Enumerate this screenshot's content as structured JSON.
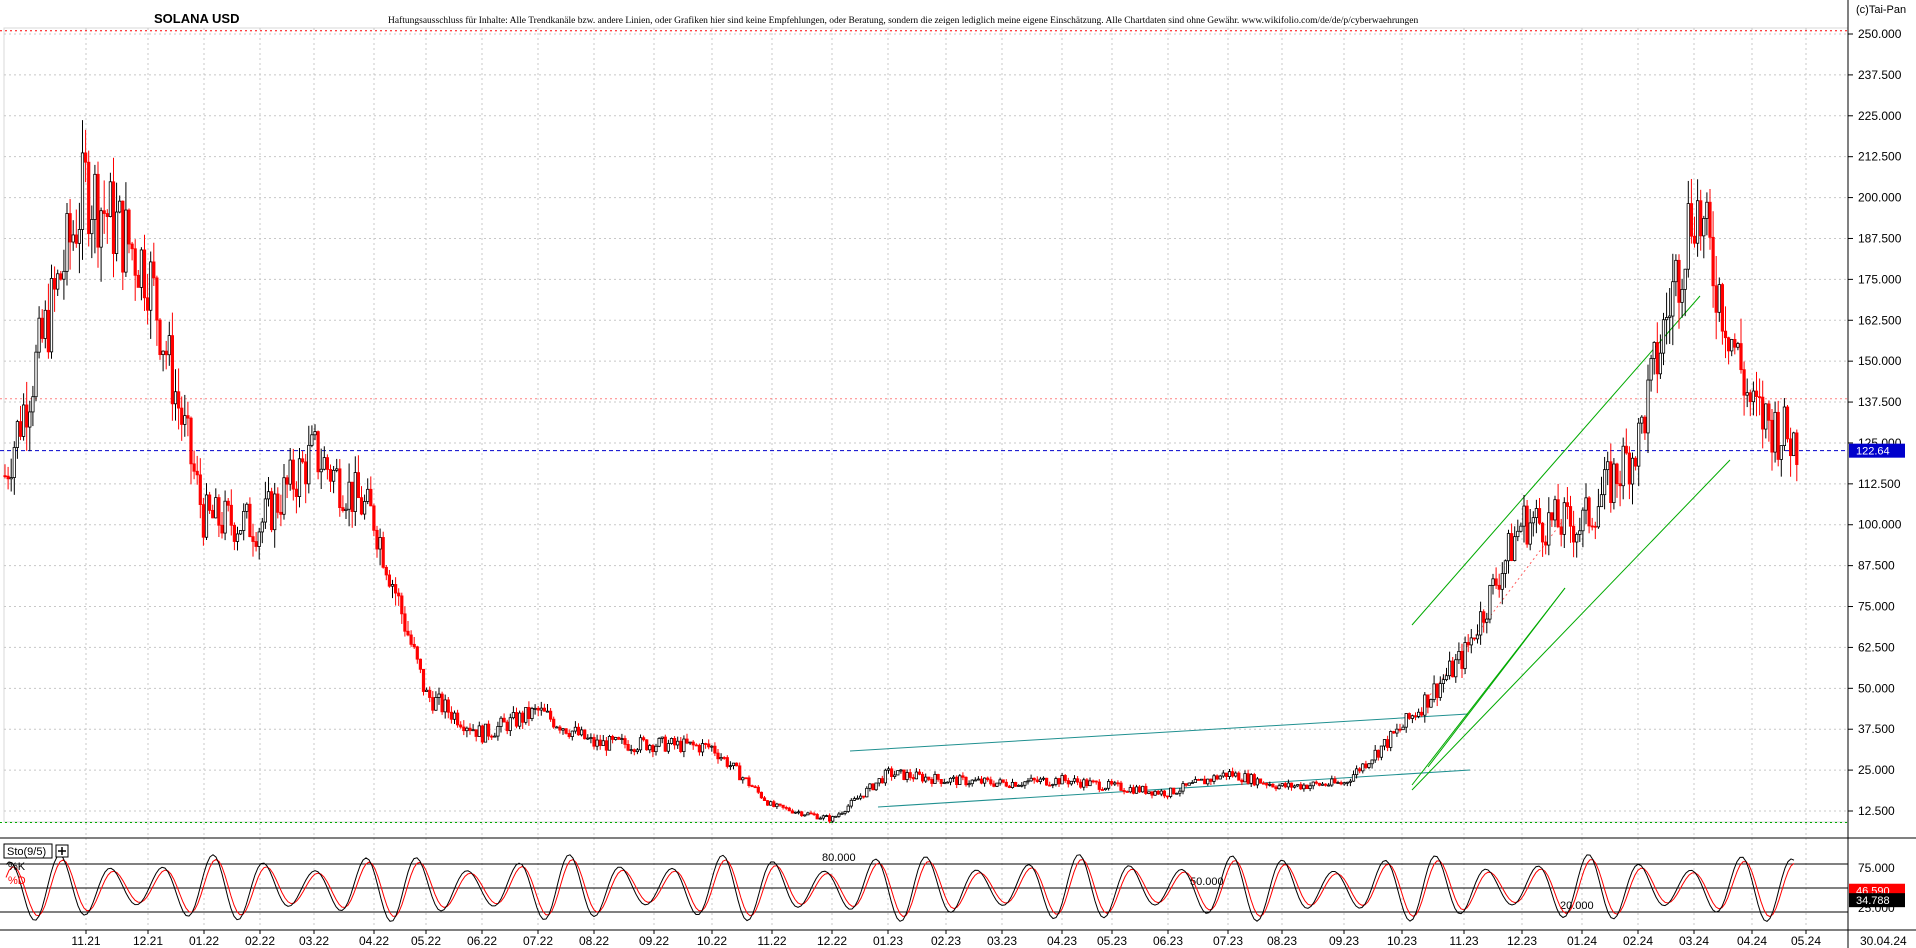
{
  "header": {
    "title": "SOLANA USD",
    "disclaimer": "Haftungsausschluss für Inhalte: Alle Trendkanäle bzw. andere Linien, oder Grafiken hier sind keine Empfehlungen, oder Beratung, sondern die zeigen lediglich meine eigene Einschätzung. Alle Chartdaten sind ohne Gewähr.  www.wikifolio.com/de/de/p/cyberwaehrungen",
    "copyright": "(c)Tai-Pan"
  },
  "colors": {
    "up": "#000000",
    "down": "#ff0000",
    "grid": "#c8c8c8",
    "channel": "#00aa00",
    "teal_channel": "#209090",
    "price_line": "#0000cc",
    "price_tag_bg": "#0000cc",
    "k_tag_bg": "#ff0000",
    "d_tag_bg": "#000000"
  },
  "chart_data": [
    {
      "type": "candlestick",
      "title": "SOLANA USD",
      "xlabel": "",
      "ylabel": "",
      "x_ticks": [
        "11.21",
        "12.21",
        "01.22",
        "02.22",
        "03.22",
        "04.22",
        "05.22",
        "06.22",
        "07.22",
        "08.22",
        "09.22",
        "10.22",
        "11.22",
        "12.22",
        "01.23",
        "02.23",
        "03.23",
        "04.23",
        "05.23",
        "06.23",
        "07.23",
        "08.23",
        "09.23",
        "10.23",
        "11.23",
        "12.23",
        "01.24",
        "02.24",
        "03.24",
        "04.24",
        "05.24"
      ],
      "x_end_label": "30.04.24",
      "y_ticks": [
        "12.500",
        "25.000",
        "37.500",
        "50.000",
        "62.500",
        "75.000",
        "87.500",
        "100.000",
        "112.500",
        "125.000",
        "137.500",
        "150.000",
        "162.500",
        "175.000",
        "187.500",
        "200.000",
        "212.500",
        "225.000",
        "237.500",
        "250.000"
      ],
      "ylim": [
        0,
        250
      ],
      "grid": true,
      "last_price": "122.64",
      "monthly_closes": [
        {
          "m": "11.21",
          "v": 204
        },
        {
          "m": "12.21",
          "v": 178
        },
        {
          "m": "01.22",
          "v": 102
        },
        {
          "m": "02.22",
          "v": 100
        },
        {
          "m": "03.22",
          "v": 122
        },
        {
          "m": "04.22",
          "v": 102
        },
        {
          "m": "05.22",
          "v": 48
        },
        {
          "m": "06.22",
          "v": 36
        },
        {
          "m": "07.22",
          "v": 43
        },
        {
          "m": "08.22",
          "v": 33
        },
        {
          "m": "09.22",
          "v": 33
        },
        {
          "m": "10.22",
          "v": 32
        },
        {
          "m": "11.22",
          "v": 14
        },
        {
          "m": "12.22",
          "v": 10
        },
        {
          "m": "01.23",
          "v": 24
        },
        {
          "m": "02.23",
          "v": 22
        },
        {
          "m": "03.23",
          "v": 21
        },
        {
          "m": "04.23",
          "v": 22
        },
        {
          "m": "05.23",
          "v": 20
        },
        {
          "m": "06.23",
          "v": 18
        },
        {
          "m": "07.23",
          "v": 24
        },
        {
          "m": "08.23",
          "v": 20
        },
        {
          "m": "09.23",
          "v": 21
        },
        {
          "m": "10.23",
          "v": 38
        },
        {
          "m": "11.23",
          "v": 60
        },
        {
          "m": "12.23",
          "v": 101
        },
        {
          "m": "01.24",
          "v": 100
        },
        {
          "m": "02.24",
          "v": 125
        },
        {
          "m": "03.24",
          "v": 200
        },
        {
          "m": "04.24",
          "v": 135
        },
        {
          "m": "05.24",
          "v": 123
        }
      ],
      "horizontal_levels": [
        {
          "value": 251,
          "color": "#ff0000",
          "style": "dotted"
        },
        {
          "value": 138.5,
          "color": "#ff8080",
          "style": "dotted"
        },
        {
          "value": 122.64,
          "color": "#0000cc",
          "style": "dashed"
        },
        {
          "value": 9,
          "color": "#00aa00",
          "style": "dotted"
        }
      ]
    },
    {
      "type": "line",
      "title": "Sto(9/5)",
      "series": [
        {
          "name": "%K",
          "color": "#000000"
        },
        {
          "name": "%D",
          "color": "#ff0000"
        }
      ],
      "y_ticks": [
        "25.000",
        "75.000"
      ],
      "ylim": [
        0,
        100
      ],
      "levels": [
        {
          "value": 80,
          "label": "80.000"
        },
        {
          "value": 50,
          "label": "50.000"
        },
        {
          "value": 20,
          "label": "20.000"
        }
      ],
      "last_k": "46.590",
      "last_d": "34.788"
    }
  ]
}
